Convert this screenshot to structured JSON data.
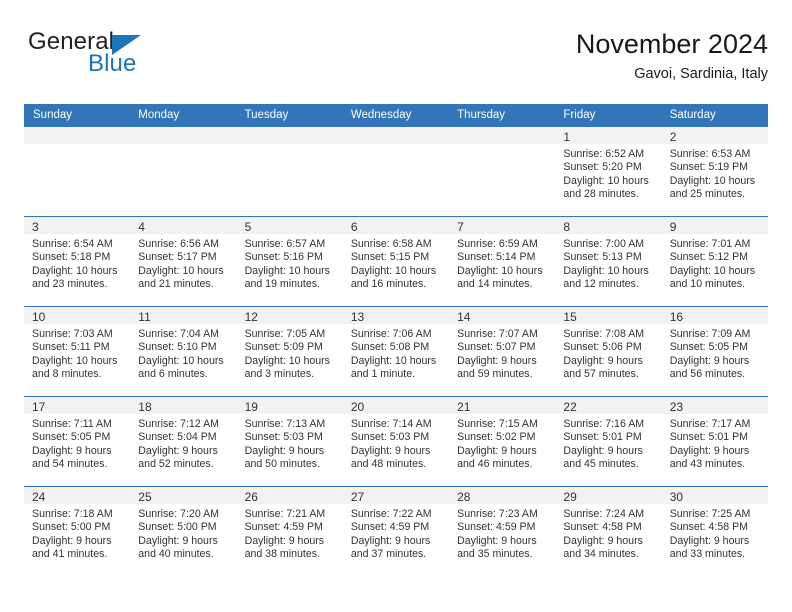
{
  "brand": {
    "name_part1": "General",
    "name_part2": "Blue",
    "triangle_color": "#1b75bb"
  },
  "header": {
    "title": "November 2024",
    "subtitle": "Gavoi, Sardinia, Italy"
  },
  "theme": {
    "header_blue": "#3275b8",
    "daynum_band": "#f2f2f2",
    "text": "#333333"
  },
  "weekday_headers": [
    "Sunday",
    "Monday",
    "Tuesday",
    "Wednesday",
    "Thursday",
    "Friday",
    "Saturday"
  ],
  "weeks": [
    [
      {
        "day": "",
        "sunrise": "",
        "sunset": "",
        "daylight_1": "",
        "daylight_2": ""
      },
      {
        "day": "",
        "sunrise": "",
        "sunset": "",
        "daylight_1": "",
        "daylight_2": ""
      },
      {
        "day": "",
        "sunrise": "",
        "sunset": "",
        "daylight_1": "",
        "daylight_2": ""
      },
      {
        "day": "",
        "sunrise": "",
        "sunset": "",
        "daylight_1": "",
        "daylight_2": ""
      },
      {
        "day": "",
        "sunrise": "",
        "sunset": "",
        "daylight_1": "",
        "daylight_2": ""
      },
      {
        "day": "1",
        "sunrise": "Sunrise: 6:52 AM",
        "sunset": "Sunset: 5:20 PM",
        "daylight_1": "Daylight: 10 hours",
        "daylight_2": "and 28 minutes."
      },
      {
        "day": "2",
        "sunrise": "Sunrise: 6:53 AM",
        "sunset": "Sunset: 5:19 PM",
        "daylight_1": "Daylight: 10 hours",
        "daylight_2": "and 25 minutes."
      }
    ],
    [
      {
        "day": "3",
        "sunrise": "Sunrise: 6:54 AM",
        "sunset": "Sunset: 5:18 PM",
        "daylight_1": "Daylight: 10 hours",
        "daylight_2": "and 23 minutes."
      },
      {
        "day": "4",
        "sunrise": "Sunrise: 6:56 AM",
        "sunset": "Sunset: 5:17 PM",
        "daylight_1": "Daylight: 10 hours",
        "daylight_2": "and 21 minutes."
      },
      {
        "day": "5",
        "sunrise": "Sunrise: 6:57 AM",
        "sunset": "Sunset: 5:16 PM",
        "daylight_1": "Daylight: 10 hours",
        "daylight_2": "and 19 minutes."
      },
      {
        "day": "6",
        "sunrise": "Sunrise: 6:58 AM",
        "sunset": "Sunset: 5:15 PM",
        "daylight_1": "Daylight: 10 hours",
        "daylight_2": "and 16 minutes."
      },
      {
        "day": "7",
        "sunrise": "Sunrise: 6:59 AM",
        "sunset": "Sunset: 5:14 PM",
        "daylight_1": "Daylight: 10 hours",
        "daylight_2": "and 14 minutes."
      },
      {
        "day": "8",
        "sunrise": "Sunrise: 7:00 AM",
        "sunset": "Sunset: 5:13 PM",
        "daylight_1": "Daylight: 10 hours",
        "daylight_2": "and 12 minutes."
      },
      {
        "day": "9",
        "sunrise": "Sunrise: 7:01 AM",
        "sunset": "Sunset: 5:12 PM",
        "daylight_1": "Daylight: 10 hours",
        "daylight_2": "and 10 minutes."
      }
    ],
    [
      {
        "day": "10",
        "sunrise": "Sunrise: 7:03 AM",
        "sunset": "Sunset: 5:11 PM",
        "daylight_1": "Daylight: 10 hours",
        "daylight_2": "and 8 minutes."
      },
      {
        "day": "11",
        "sunrise": "Sunrise: 7:04 AM",
        "sunset": "Sunset: 5:10 PM",
        "daylight_1": "Daylight: 10 hours",
        "daylight_2": "and 6 minutes."
      },
      {
        "day": "12",
        "sunrise": "Sunrise: 7:05 AM",
        "sunset": "Sunset: 5:09 PM",
        "daylight_1": "Daylight: 10 hours",
        "daylight_2": "and 3 minutes."
      },
      {
        "day": "13",
        "sunrise": "Sunrise: 7:06 AM",
        "sunset": "Sunset: 5:08 PM",
        "daylight_1": "Daylight: 10 hours",
        "daylight_2": "and 1 minute."
      },
      {
        "day": "14",
        "sunrise": "Sunrise: 7:07 AM",
        "sunset": "Sunset: 5:07 PM",
        "daylight_1": "Daylight: 9 hours",
        "daylight_2": "and 59 minutes."
      },
      {
        "day": "15",
        "sunrise": "Sunrise: 7:08 AM",
        "sunset": "Sunset: 5:06 PM",
        "daylight_1": "Daylight: 9 hours",
        "daylight_2": "and 57 minutes."
      },
      {
        "day": "16",
        "sunrise": "Sunrise: 7:09 AM",
        "sunset": "Sunset: 5:05 PM",
        "daylight_1": "Daylight: 9 hours",
        "daylight_2": "and 56 minutes."
      }
    ],
    [
      {
        "day": "17",
        "sunrise": "Sunrise: 7:11 AM",
        "sunset": "Sunset: 5:05 PM",
        "daylight_1": "Daylight: 9 hours",
        "daylight_2": "and 54 minutes."
      },
      {
        "day": "18",
        "sunrise": "Sunrise: 7:12 AM",
        "sunset": "Sunset: 5:04 PM",
        "daylight_1": "Daylight: 9 hours",
        "daylight_2": "and 52 minutes."
      },
      {
        "day": "19",
        "sunrise": "Sunrise: 7:13 AM",
        "sunset": "Sunset: 5:03 PM",
        "daylight_1": "Daylight: 9 hours",
        "daylight_2": "and 50 minutes."
      },
      {
        "day": "20",
        "sunrise": "Sunrise: 7:14 AM",
        "sunset": "Sunset: 5:03 PM",
        "daylight_1": "Daylight: 9 hours",
        "daylight_2": "and 48 minutes."
      },
      {
        "day": "21",
        "sunrise": "Sunrise: 7:15 AM",
        "sunset": "Sunset: 5:02 PM",
        "daylight_1": "Daylight: 9 hours",
        "daylight_2": "and 46 minutes."
      },
      {
        "day": "22",
        "sunrise": "Sunrise: 7:16 AM",
        "sunset": "Sunset: 5:01 PM",
        "daylight_1": "Daylight: 9 hours",
        "daylight_2": "and 45 minutes."
      },
      {
        "day": "23",
        "sunrise": "Sunrise: 7:17 AM",
        "sunset": "Sunset: 5:01 PM",
        "daylight_1": "Daylight: 9 hours",
        "daylight_2": "and 43 minutes."
      }
    ],
    [
      {
        "day": "24",
        "sunrise": "Sunrise: 7:18 AM",
        "sunset": "Sunset: 5:00 PM",
        "daylight_1": "Daylight: 9 hours",
        "daylight_2": "and 41 minutes."
      },
      {
        "day": "25",
        "sunrise": "Sunrise: 7:20 AM",
        "sunset": "Sunset: 5:00 PM",
        "daylight_1": "Daylight: 9 hours",
        "daylight_2": "and 40 minutes."
      },
      {
        "day": "26",
        "sunrise": "Sunrise: 7:21 AM",
        "sunset": "Sunset: 4:59 PM",
        "daylight_1": "Daylight: 9 hours",
        "daylight_2": "and 38 minutes."
      },
      {
        "day": "27",
        "sunrise": "Sunrise: 7:22 AM",
        "sunset": "Sunset: 4:59 PM",
        "daylight_1": "Daylight: 9 hours",
        "daylight_2": "and 37 minutes."
      },
      {
        "day": "28",
        "sunrise": "Sunrise: 7:23 AM",
        "sunset": "Sunset: 4:59 PM",
        "daylight_1": "Daylight: 9 hours",
        "daylight_2": "and 35 minutes."
      },
      {
        "day": "29",
        "sunrise": "Sunrise: 7:24 AM",
        "sunset": "Sunset: 4:58 PM",
        "daylight_1": "Daylight: 9 hours",
        "daylight_2": "and 34 minutes."
      },
      {
        "day": "30",
        "sunrise": "Sunrise: 7:25 AM",
        "sunset": "Sunset: 4:58 PM",
        "daylight_1": "Daylight: 9 hours",
        "daylight_2": "and 33 minutes."
      }
    ]
  ]
}
